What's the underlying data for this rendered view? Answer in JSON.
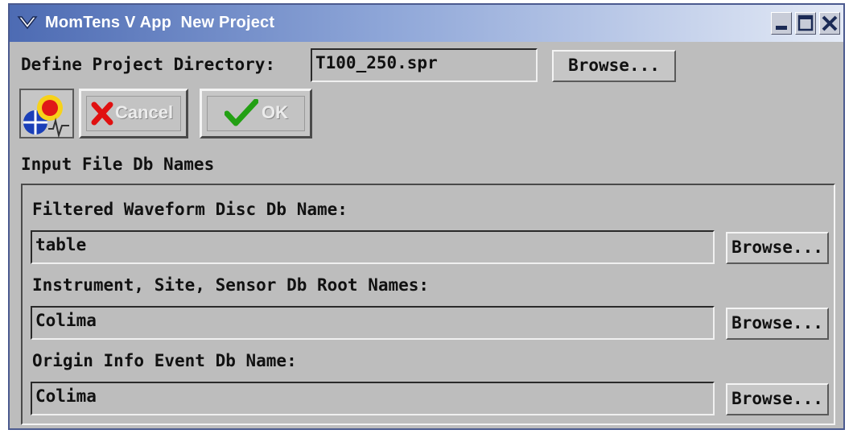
{
  "window": {
    "title": "MomTens V App  New Project"
  },
  "project": {
    "dir_label": "Define Project Directory:",
    "dir_value": "T100_250.spr",
    "browse_label": "Browse..."
  },
  "toolbar": {
    "cancel_label": "Cancel",
    "ok_label": "OK"
  },
  "inputs": {
    "section_label": "Input File Db Names",
    "waveform": {
      "label": "Filtered Waveform Disc Db Name:",
      "value": "table",
      "browse_label": "Browse..."
    },
    "instrument": {
      "label": "Instrument, Site, Sensor Db Root Names:",
      "value": "Colima",
      "browse_label": "Browse..."
    },
    "origin": {
      "label": "Origin Info Event Db Name:",
      "value": "Colima",
      "browse_label": "Browse..."
    }
  },
  "colors": {
    "window_bg": "#bdbdbd",
    "titlebar_start": "#4d6bb3",
    "titlebar_end": "#e4eaf6",
    "cancel_x": "#e01010",
    "ok_check": "#23a014"
  },
  "icons": [
    "window-menu-icon",
    "minimize-icon",
    "maximize-icon",
    "close-icon",
    "app-logo-icon",
    "cancel-x-icon",
    "ok-check-icon"
  ]
}
